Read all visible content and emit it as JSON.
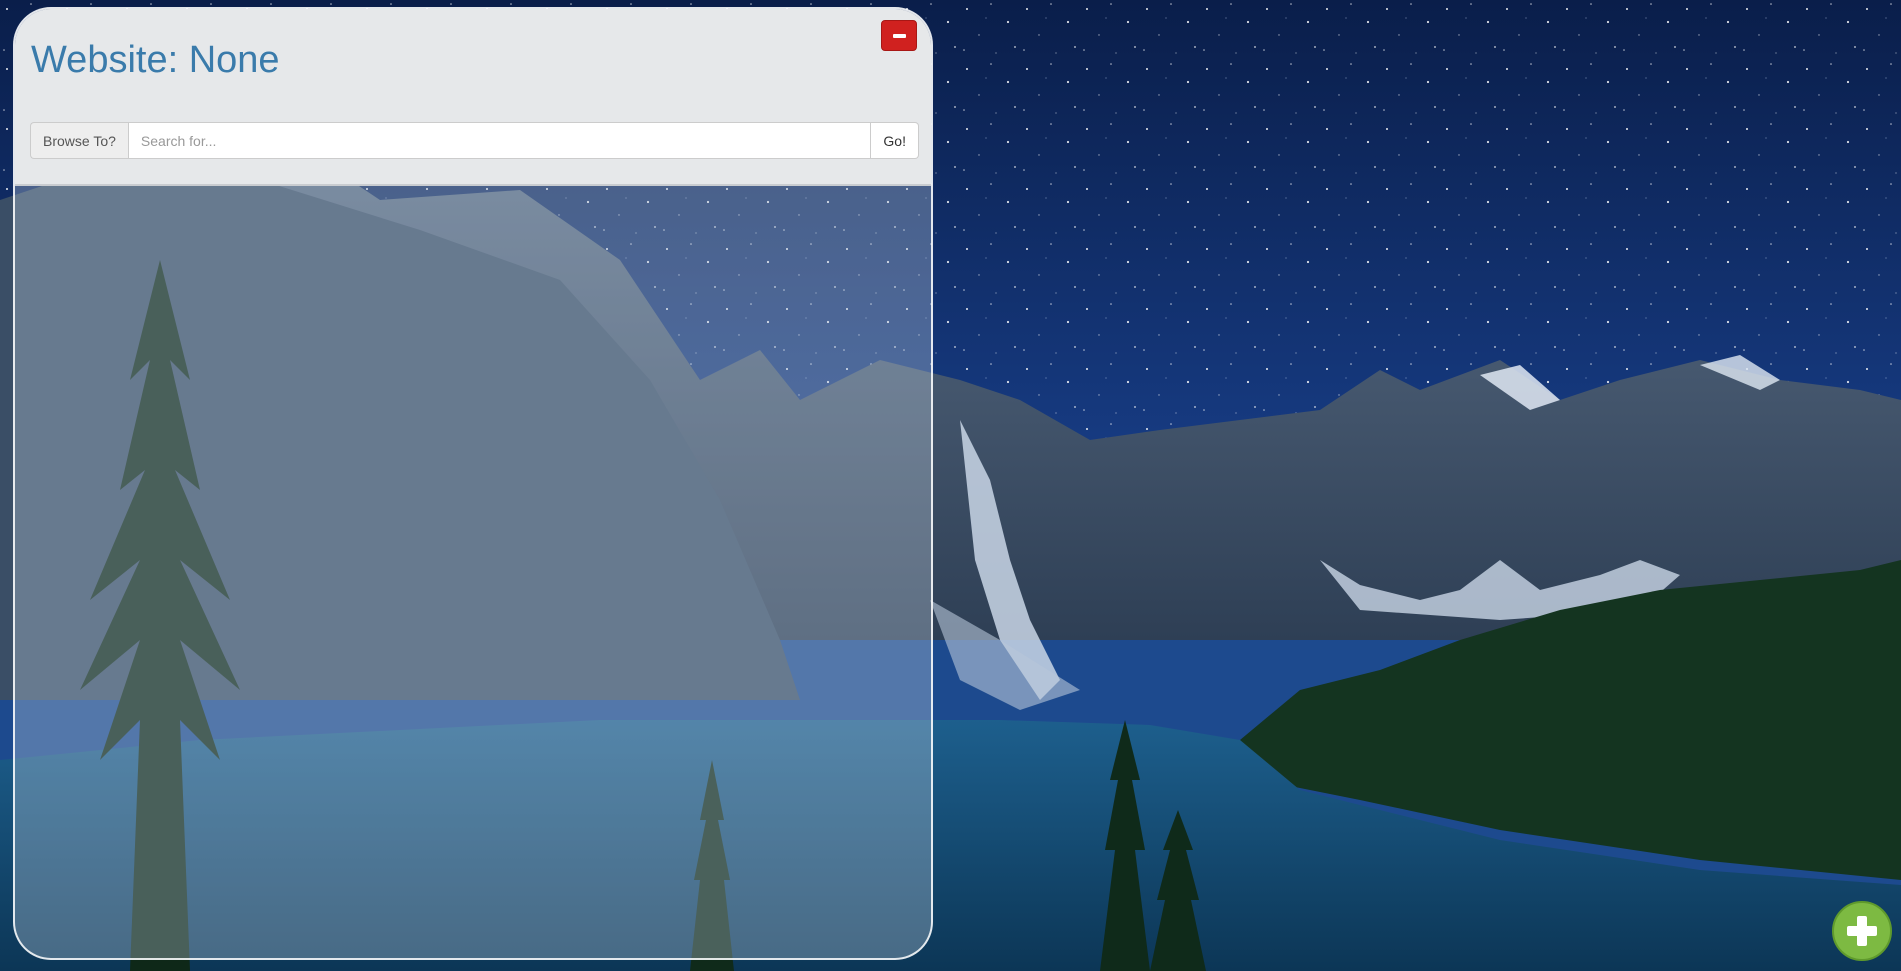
{
  "widget": {
    "title": "Website: None",
    "minimize_icon": "minus-icon",
    "browse": {
      "label": "Browse To?",
      "placeholder": "Search for...",
      "value": "",
      "go_label": "Go!"
    }
  },
  "fab": {
    "icon": "plus-icon"
  },
  "colors": {
    "title": "#3a7bab",
    "minimize_button": "#d0211f",
    "add_button": "#7dba42",
    "header_bg": "#e6e8ea"
  }
}
